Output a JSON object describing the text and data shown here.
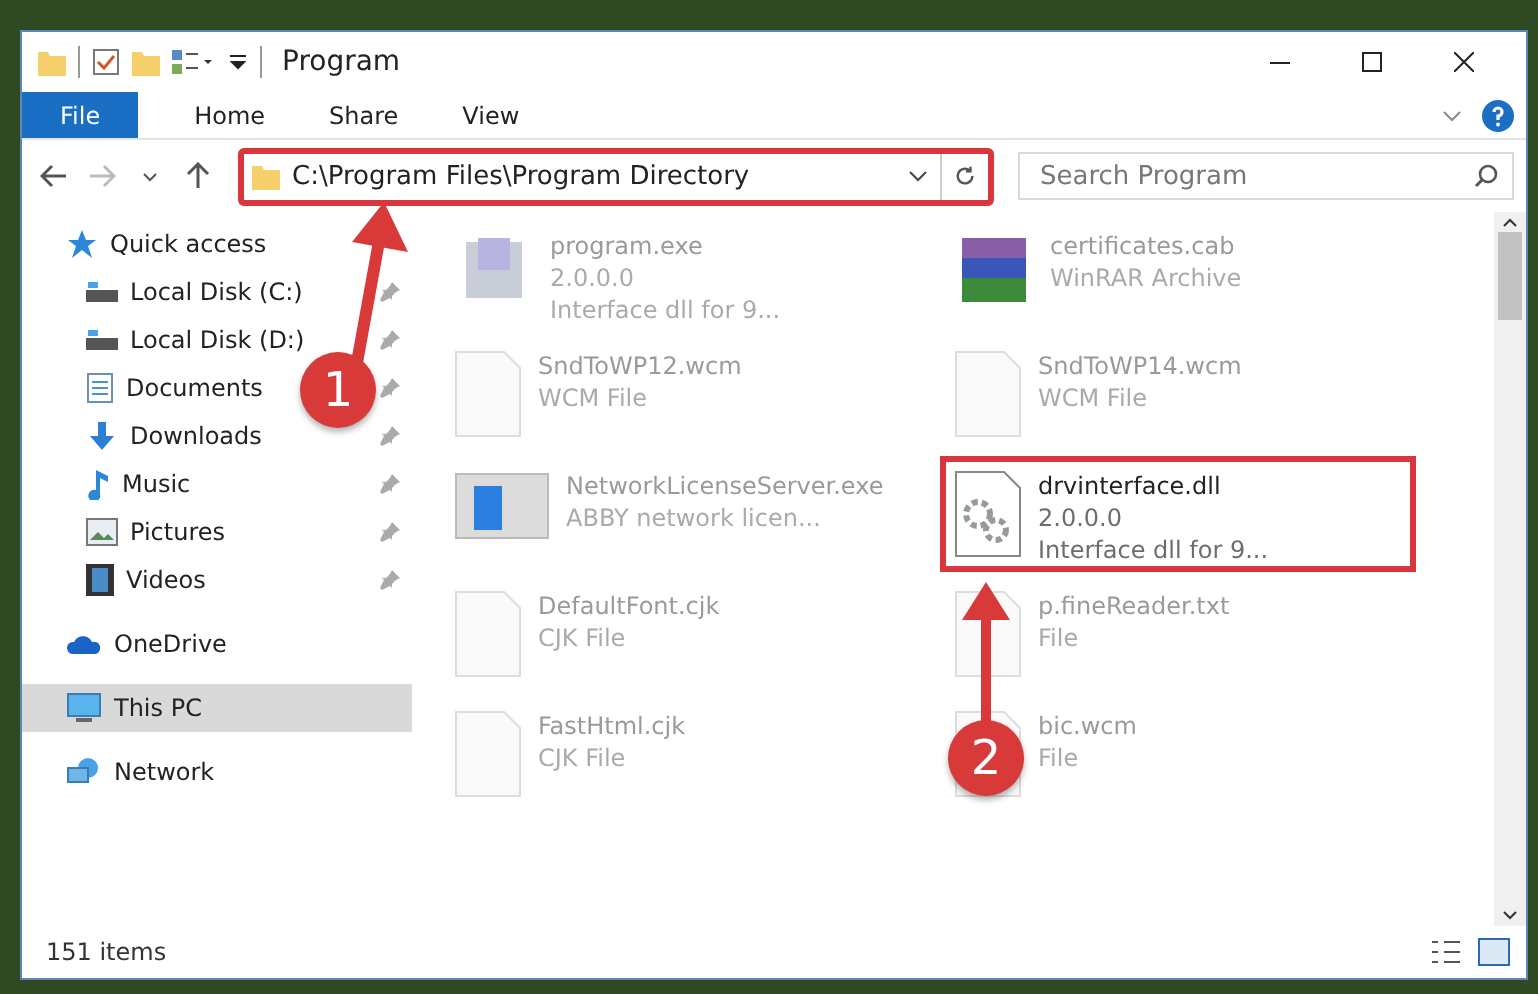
{
  "window": {
    "title": "Program"
  },
  "ribbon_tabs": [
    {
      "label": "File",
      "selected": true
    },
    {
      "label": "Home",
      "selected": false
    },
    {
      "label": "Share",
      "selected": false
    },
    {
      "label": "View",
      "selected": false
    }
  ],
  "address": {
    "path": "C:\\Program Files\\Program Directory",
    "outlined": true
  },
  "search": {
    "placeholder": "Search Program"
  },
  "sidebar": {
    "items": [
      {
        "label": "Quick access",
        "kind": "star",
        "selected": false,
        "children": [
          {
            "label": "Local Disk (C:)",
            "kind": "disk",
            "selected": false,
            "pinned": true
          },
          {
            "label": "Local Disk (D:)",
            "kind": "disk",
            "selected": false,
            "pinned": true
          },
          {
            "label": "Documents",
            "kind": "document",
            "selected": false,
            "pinned": true
          },
          {
            "label": "Downloads",
            "kind": "download",
            "selected": false,
            "pinned": true
          },
          {
            "label": "Music",
            "kind": "music",
            "selected": false,
            "pinned": true
          },
          {
            "label": "Pictures",
            "kind": "picture",
            "selected": false,
            "pinned": true
          },
          {
            "label": "Videos",
            "kind": "video",
            "selected": false,
            "pinned": true
          }
        ]
      },
      {
        "label": "OneDrive",
        "kind": "cloud",
        "selected": false
      },
      {
        "label": "This PC",
        "kind": "pc",
        "selected": true
      },
      {
        "label": "Network",
        "kind": "network",
        "selected": false
      }
    ]
  },
  "files": [
    {
      "name": "program.exe",
      "lines": [
        "2.0.0.0",
        "Interface dll for 9..."
      ],
      "kind": "exe",
      "blurred": true,
      "outlined": false
    },
    {
      "name": "certificates.cab",
      "lines": [
        "WinRAR Archive"
      ],
      "kind": "archive",
      "blurred": true,
      "outlined": false
    },
    {
      "name": "SndToWP12.wcm",
      "lines": [
        "WCM File"
      ],
      "kind": "blank",
      "blurred": true,
      "outlined": false
    },
    {
      "name": "SndToWP14.wcm",
      "lines": [
        "WCM File"
      ],
      "kind": "blank",
      "blurred": true,
      "outlined": false
    },
    {
      "name": "NetworkLicenseServer.exe",
      "lines": [
        "ABBY network licen..."
      ],
      "kind": "window",
      "blurred": true,
      "outlined": false
    },
    {
      "name": "drvinterface.dll",
      "lines": [
        "2.0.0.0",
        "Interface dll for 9..."
      ],
      "kind": "dll",
      "blurred": false,
      "outlined": true
    },
    {
      "name": "DefaultFont.cjk",
      "lines": [
        "CJK File"
      ],
      "kind": "blank",
      "blurred": true,
      "outlined": false
    },
    {
      "name": "p.fineReader.txt",
      "lines": [
        "File"
      ],
      "kind": "blank",
      "blurred": true,
      "outlined": false
    },
    {
      "name": "FastHtml.cjk",
      "lines": [
        "CJK File"
      ],
      "kind": "blank",
      "blurred": true,
      "outlined": false
    },
    {
      "name": "bic.wcm",
      "lines": [
        "File"
      ],
      "kind": "blank",
      "blurred": true,
      "outlined": false
    }
  ],
  "status_bar": {
    "count": "151 items"
  },
  "callouts": [
    {
      "number": "1"
    },
    {
      "number": "2"
    }
  ]
}
